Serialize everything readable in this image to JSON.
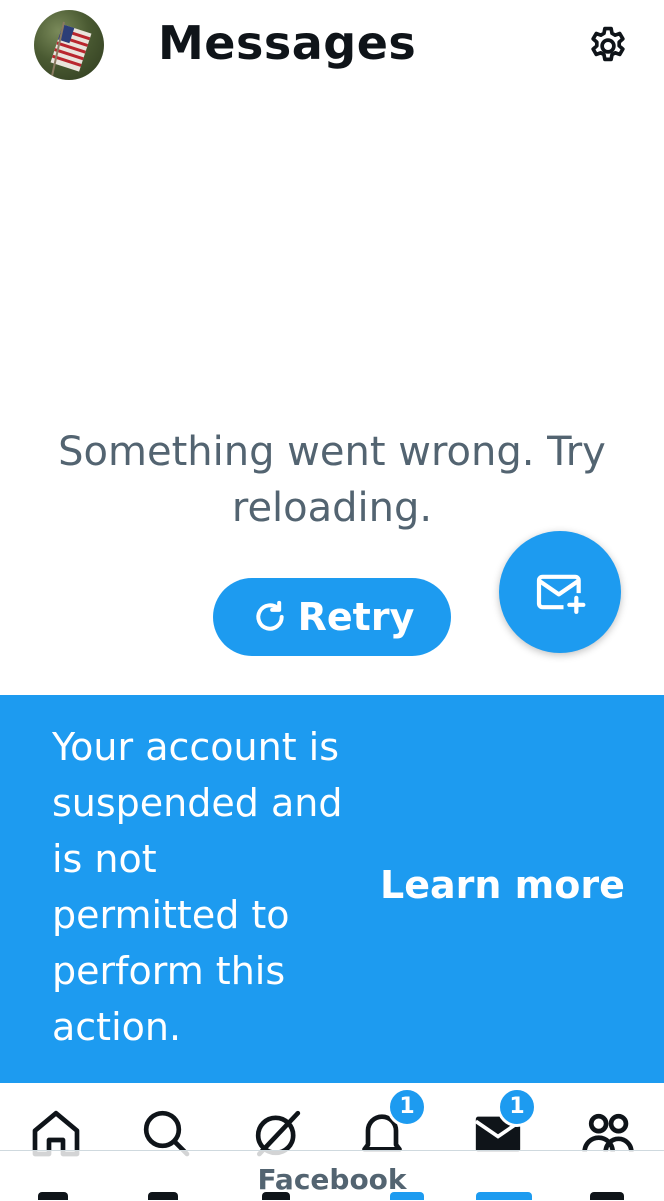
{
  "header": {
    "title": "Messages",
    "avatar_icon": "profile-avatar-flag",
    "settings_icon": "gear-icon"
  },
  "error": {
    "message": "Something went wrong. Try reloading.",
    "retry_label": "Retry",
    "retry_icon": "refresh-icon"
  },
  "fab": {
    "icon": "new-message-icon"
  },
  "banner": {
    "message": "Your account is suspended and is not permitted to perform this action.",
    "link_label": "Learn more"
  },
  "tabbar": {
    "tabs": [
      {
        "name": "home",
        "icon": "home-icon"
      },
      {
        "name": "search",
        "icon": "search-icon"
      },
      {
        "name": "grok",
        "icon": "grok-icon"
      },
      {
        "name": "notifications",
        "icon": "bell-icon",
        "badge": "1"
      },
      {
        "name": "messages",
        "icon": "envelope-icon",
        "badge": "1"
      },
      {
        "name": "communities",
        "icon": "people-icon"
      }
    ]
  },
  "overlay": {
    "label": "Facebook"
  },
  "colors": {
    "accent": "#1d9bf0",
    "text_primary": "#0f1419",
    "text_secondary": "#536471"
  }
}
